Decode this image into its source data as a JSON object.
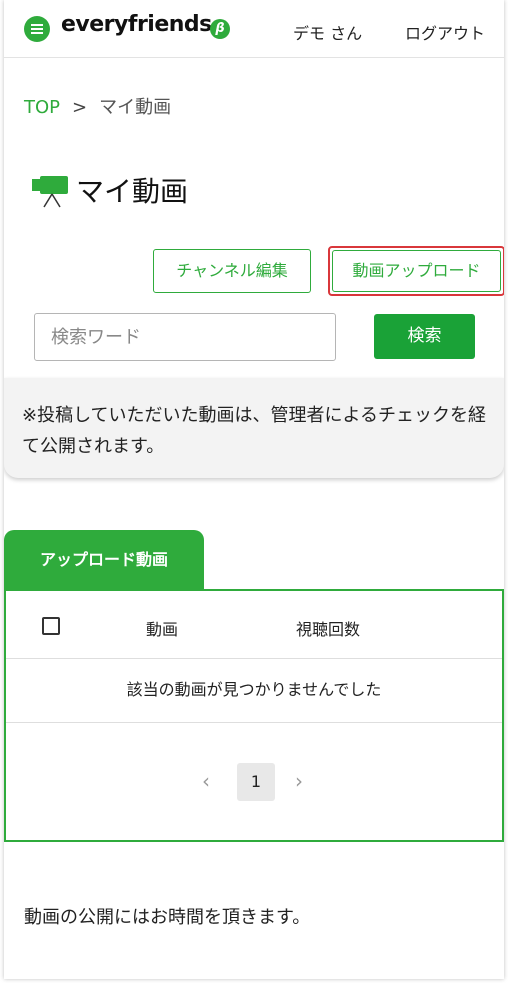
{
  "header": {
    "logo_text": "everyfriends",
    "logo_mark": "β",
    "user_name": "デモ さん",
    "logout_label": "ログアウト"
  },
  "breadcrumb": {
    "top": "TOP",
    "separator": ">",
    "current": "マイ動画"
  },
  "page": {
    "title": "マイ動画",
    "title_icon": "video-camera-icon"
  },
  "actions": {
    "channel_edit_label": "チャンネル編集",
    "upload_label": "動画アップロード"
  },
  "search": {
    "placeholder": "検索ワード",
    "value": "",
    "button_label": "検索"
  },
  "notice": {
    "text": "※投稿していただいた動画は、管理者によるチェックを経て公開されます。"
  },
  "tabs": [
    {
      "label": "アップロード動画",
      "active": true
    }
  ],
  "table": {
    "columns": [
      "動画",
      "視聴回数"
    ],
    "empty_message": "該当の動画が見つかりませんでした"
  },
  "pagination": {
    "prev": "‹",
    "current_page": "1",
    "next": "›"
  },
  "footer": {
    "note": "動画の公開にはお時間を頂きます。"
  },
  "colors": {
    "brand_green": "#2fab3c",
    "highlight_red": "#d9373b"
  }
}
